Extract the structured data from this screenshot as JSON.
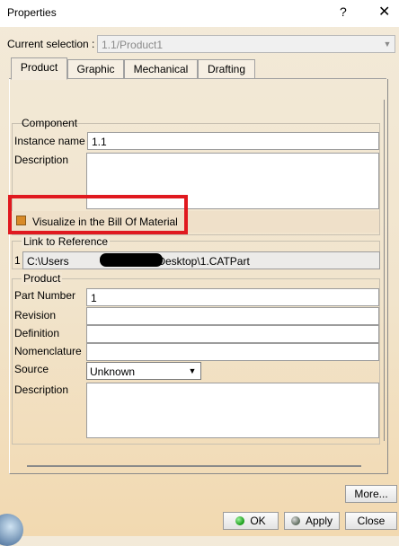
{
  "window": {
    "title": "Properties",
    "help_glyph": "?",
    "close_glyph": "✕"
  },
  "selection": {
    "label": "Current selection :",
    "value": "1.1/Product1"
  },
  "tabs": [
    "Product",
    "Graphic",
    "Mechanical",
    "Drafting"
  ],
  "component": {
    "group_label": "Component",
    "instance_name_label": "Instance name",
    "instance_name_value": "1.1",
    "description_label": "Description",
    "description_value": "",
    "bom_label": "Visualize in the Bill Of Material",
    "bom_checked": true
  },
  "link": {
    "group_label": "Link to Reference",
    "index": "1",
    "path_prefix": "C:\\Users",
    "path_suffix": "\\Desktop\\1.CATPart"
  },
  "product": {
    "group_label": "Product",
    "part_number_label": "Part Number",
    "part_number_value": "1",
    "revision_label": "Revision",
    "revision_value": "",
    "definition_label": "Definition",
    "definition_value": "",
    "nomenclature_label": "Nomenclature",
    "nomenclature_value": "",
    "source_label": "Source",
    "source_value": "Unknown",
    "description_label": "Description",
    "description_value": ""
  },
  "buttons": {
    "more": "More...",
    "ok": "OK",
    "apply": "Apply",
    "close": "Close"
  },
  "colors": {
    "highlight": "#e0191f",
    "checkbox": "#d88a28",
    "ok_led": "#159a15"
  }
}
